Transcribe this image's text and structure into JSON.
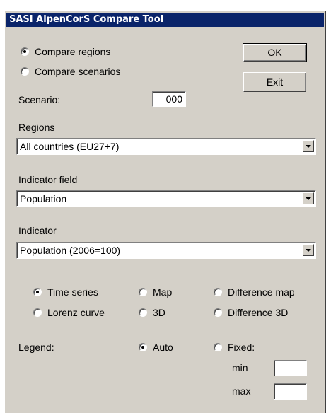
{
  "window": {
    "title": "SASI AlpenCorS Compare Tool"
  },
  "compare_mode": {
    "options": [
      {
        "label": "Compare regions",
        "checked": true
      },
      {
        "label": "Compare scenarios",
        "checked": false
      }
    ]
  },
  "buttons": {
    "ok_label": "OK",
    "exit_label": "Exit"
  },
  "scenario": {
    "label": "Scenario:",
    "value": "000"
  },
  "regions": {
    "label": "Regions",
    "selected": "All countries (EU27+7)"
  },
  "indicator_field": {
    "label": "Indicator field",
    "selected": "Population"
  },
  "indicator": {
    "label": "Indicator",
    "selected": "Population (2006=100)"
  },
  "display_type": {
    "options": [
      {
        "label": "Time series",
        "checked": true
      },
      {
        "label": "Map",
        "checked": false
      },
      {
        "label": "Difference map",
        "checked": false
      },
      {
        "label": "Lorenz curve",
        "checked": false
      },
      {
        "label": "3D",
        "checked": false
      },
      {
        "label": "Difference 3D",
        "checked": false
      }
    ]
  },
  "legend": {
    "label": "Legend:",
    "auto_label": "Auto",
    "auto_checked": true,
    "fixed_label": "Fixed:",
    "fixed_checked": false,
    "min_label": "min",
    "min_value": "",
    "max_label": "max",
    "max_value": ""
  }
}
